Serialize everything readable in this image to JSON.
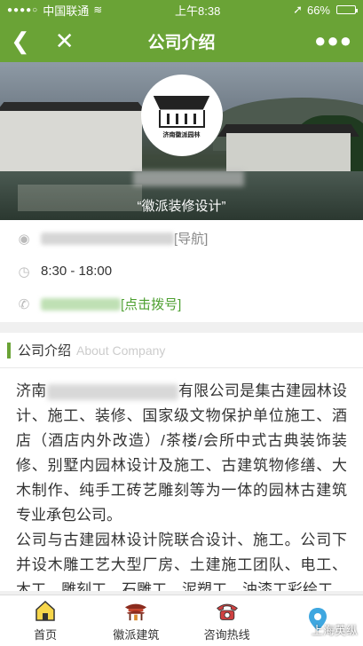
{
  "status": {
    "carrier": "中国联通",
    "time": "上午8:38",
    "battery": "66%",
    "battery_level": 0.66
  },
  "nav": {
    "back_icon": "chevron-left-icon",
    "close_icon": "close-icon",
    "title": "公司介绍",
    "more_icon": "more-dots-icon"
  },
  "hero": {
    "logo_text": "济南徽派园林",
    "slogan": "“徽派装修设计”"
  },
  "info": {
    "address_suffix": "[导航]",
    "hours": "8:30 - 18:00",
    "phone_action": "[点击拨号]"
  },
  "intro": {
    "title": "公司介绍",
    "subtitle": "About Company",
    "p1_prefix": "济南",
    "p1_rest": "有限公司是集古建园林设计、施工、装修、国家级文物保护单位施工、酒店（酒店内外改造）/茶楼/会所中式古典装饰装修、别墅内园林设计及施工、古建筑物修缮、大木制作、纯手工砖艺雕刻等为一体的园林古建筑专业承包公司。",
    "p2": "公司与古建园林设计院联合设计、施工。公司下并设木雕工艺大型厂房、土建施工团队、电工、木工、雕刻工、石雕工、泥塑工、油漆工彩绘工"
  },
  "tabs": [
    {
      "label": "首页",
      "icon": "home-icon"
    },
    {
      "label": "徽派建筑",
      "icon": "pavilion-icon"
    },
    {
      "label": "咨询热线",
      "icon": "phone-icon"
    },
    {
      "label": "",
      "icon": "location-pin-icon"
    }
  ],
  "watermark": "上海英纵",
  "colors": {
    "brand_green": "#6aa336",
    "link_green": "#4c9f2f"
  }
}
